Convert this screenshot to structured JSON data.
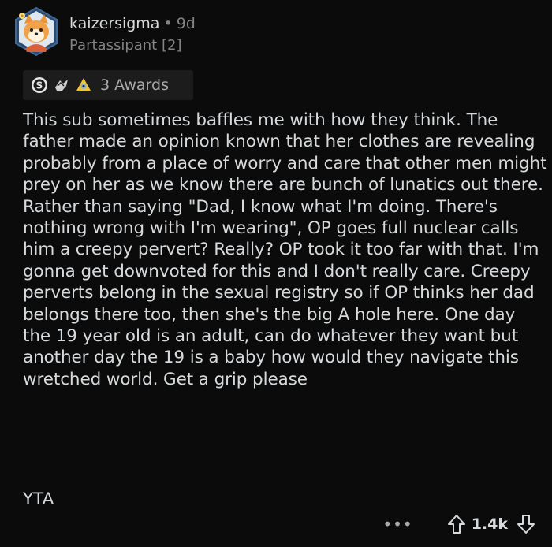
{
  "post": {
    "username": "kaizersigma",
    "separator": "•",
    "age": "9d",
    "flair": "Partassipant [2]",
    "awards_label": "3 Awards",
    "award_icons": [
      "silver-award-icon",
      "wholesome-award-icon",
      "helpful-award-icon"
    ],
    "body": "This sub sometimes baffles me with how they think. The father made an opinion known that her clothes are revealing probably from a place of worry and care that other men might prey on her as we know there are bunch of lunatics out there. Rather than saying \"Dad, I know what I'm doing. There's nothing wrong with I'm wearing\", OP goes full nuclear calls him a creepy pervert? Really? OP took it too far with that. I'm gonna get downvoted for this and I don't really care. Creepy perverts belong in the sexual registry so if OP thinks her dad belongs there too, then she's the big A hole here. One day the 19 year old is an adult, can do whatever they want but another day the 19 is a baby how would they navigate this wretched world. Get a grip please",
    "verdict": "YTA",
    "score": "1.4k",
    "more_label": "•••"
  },
  "colors": {
    "background": "#0b0b0b",
    "text": "#d7dadc",
    "muted": "#818384",
    "award_bg": "#1c1c1c"
  }
}
